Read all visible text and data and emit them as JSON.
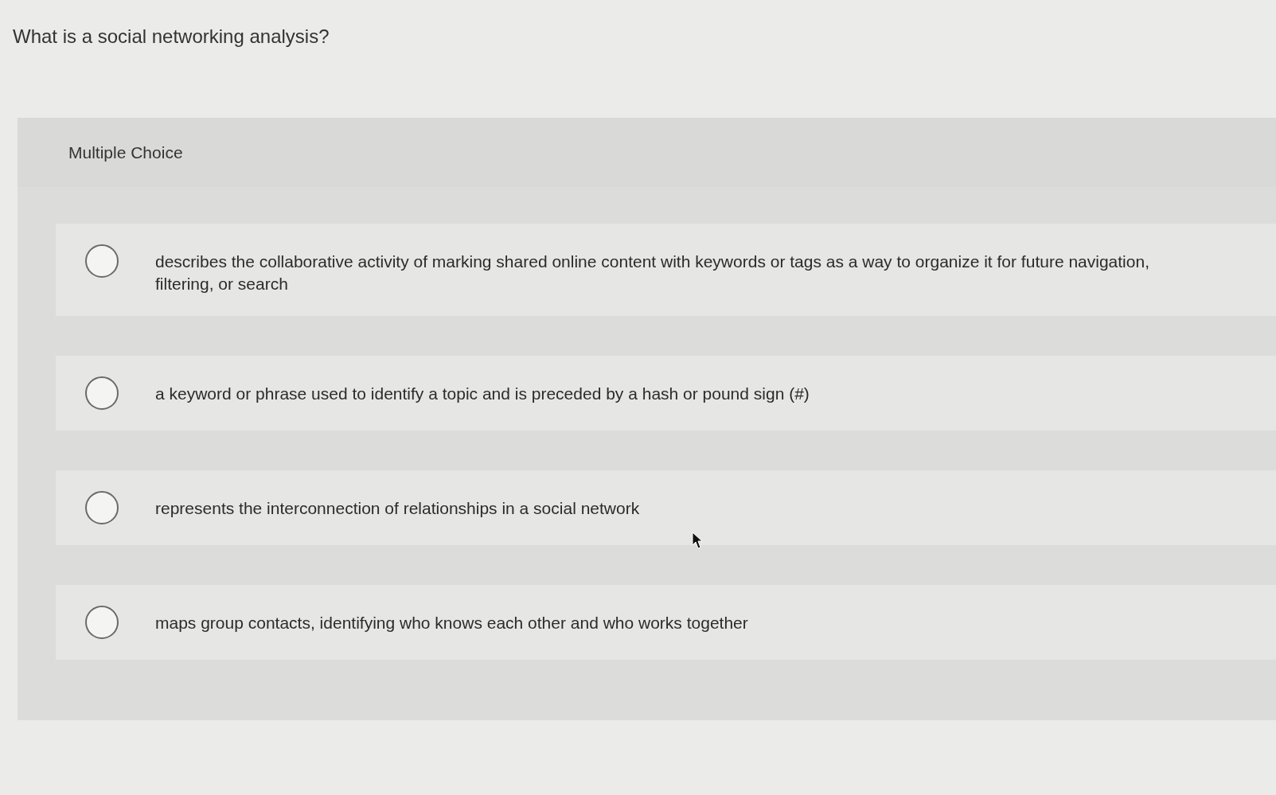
{
  "question": "What is a social networking analysis?",
  "section": {
    "label": "Multiple Choice"
  },
  "options": [
    {
      "text": "describes the collaborative activity of marking shared online content with keywords or tags as a way to organize it for future navigation, filtering, or search",
      "selected": false
    },
    {
      "text": "a keyword or phrase used to identify a topic and is preceded by a hash or pound sign (#)",
      "selected": false
    },
    {
      "text": "represents the interconnection of relationships in a social network",
      "selected": false
    },
    {
      "text": "maps group contacts, identifying who knows each other and who works together",
      "selected": false
    }
  ]
}
